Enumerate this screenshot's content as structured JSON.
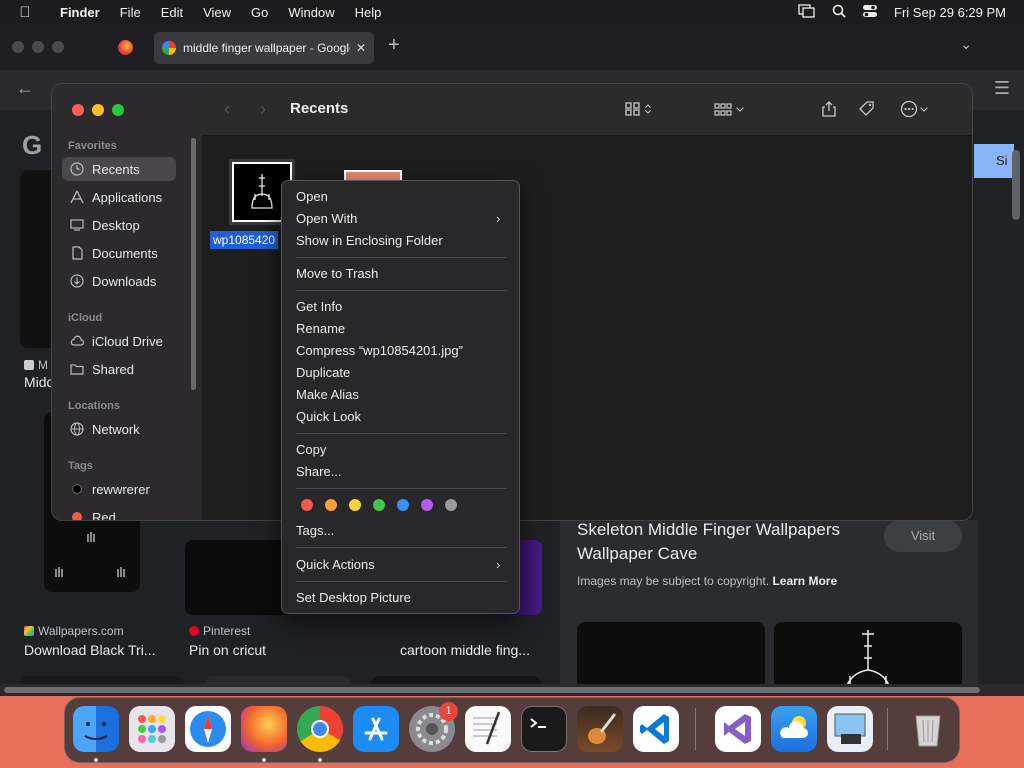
{
  "menubar": {
    "app": "Finder",
    "items": [
      "File",
      "Edit",
      "View",
      "Go",
      "Window",
      "Help"
    ],
    "clock": "Fri Sep 29  6:29 PM"
  },
  "browser": {
    "tab_title": "middle finger wallpaper - Google",
    "results": [
      {
        "source": "M",
        "caption": "Midd"
      },
      {
        "source": "Wallpapers.com",
        "caption": "Download Black Tri..."
      },
      {
        "source": "Pinterest",
        "caption": "Pin on cricut"
      },
      {
        "source": "",
        "caption": "cartoon middle fing..."
      }
    ],
    "panel": {
      "title_line1": "Skeleton Middle Finger Wallpapers",
      "title_line2": "Wallpaper Cave",
      "copyright_note": "Images may be subject to copyright.",
      "learn_more": "Learn More",
      "visit": "Visit"
    },
    "sign_in": "Si",
    "google_partial": "G"
  },
  "finder": {
    "title": "Recents",
    "sidebar": {
      "favorites_header": "Favorites",
      "favorites": [
        "Recents",
        "Applications",
        "Desktop",
        "Documents",
        "Downloads"
      ],
      "icloud_header": "iCloud",
      "icloud": [
        "iCloud Drive",
        "Shared"
      ],
      "locations_header": "Locations",
      "locations": [
        "Network"
      ],
      "tags_header": "Tags",
      "tags": [
        "rewwrerer",
        "Red"
      ]
    },
    "selected_file": "wp1085420"
  },
  "context_menu": {
    "items": {
      "open": "Open",
      "open_with": "Open With",
      "show_enclosing": "Show in Enclosing Folder",
      "move_to_trash": "Move to Trash",
      "get_info": "Get Info",
      "rename": "Rename",
      "compress": "Compress “wp10854201.jpg”",
      "duplicate": "Duplicate",
      "make_alias": "Make Alias",
      "quick_look": "Quick Look",
      "copy": "Copy",
      "share": "Share...",
      "tags": "Tags...",
      "quick_actions": "Quick Actions",
      "set_desktop": "Set Desktop Picture"
    },
    "tag_colors": [
      "#f05a4f",
      "#f5a13a",
      "#f5d43a",
      "#46c34a",
      "#3a8ef5",
      "#b45cf0",
      "#9a9a9c"
    ]
  },
  "dock": {
    "apps": [
      "Finder",
      "Launchpad",
      "Safari",
      "Firefox",
      "Google Chrome",
      "App Store",
      "System Settings",
      "TextEdit",
      "Terminal",
      "GarageBand",
      "Visual Studio Code",
      "Visual Studio",
      "Weather",
      "Preview",
      "Trash"
    ],
    "settings_badge": "1"
  }
}
